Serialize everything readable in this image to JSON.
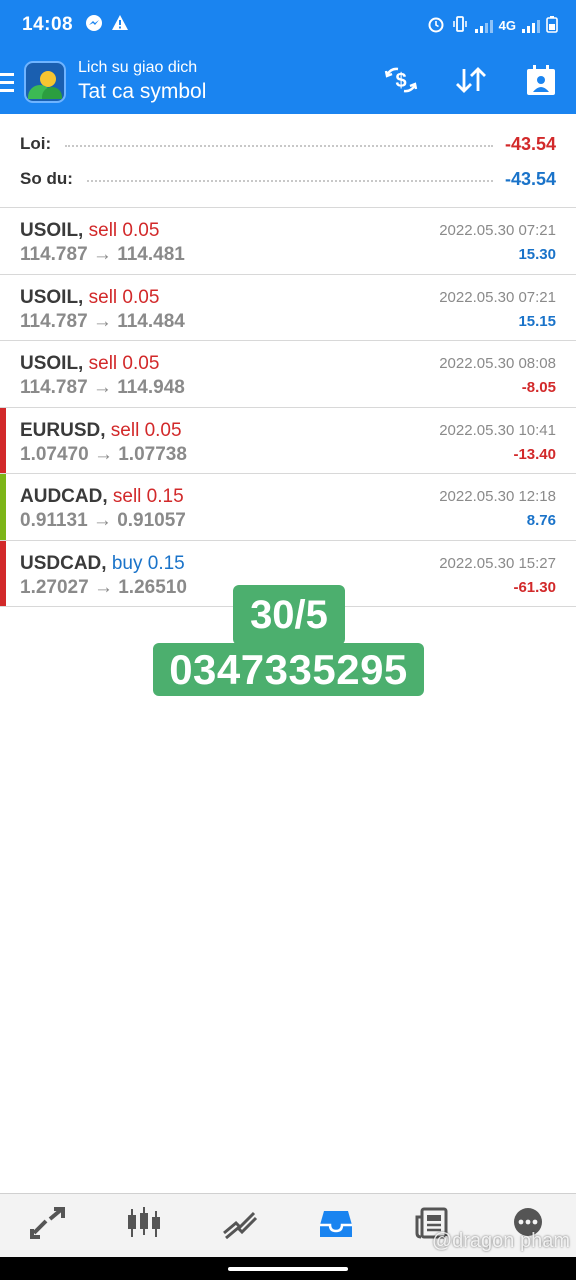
{
  "status_bar": {
    "time": "14:08",
    "network": "4G"
  },
  "app_bar": {
    "subtitle": "Lich su giao dich",
    "title": "Tat ca symbol",
    "icons": [
      "menu-icon",
      "app-logo",
      "currency-exchange-icon",
      "sort-icon",
      "calendar-icon"
    ]
  },
  "summary": {
    "profit_label": "Loi:",
    "profit_value": "-43.54",
    "balance_label": "So du:",
    "balance_value": "-43.54"
  },
  "trades": [
    {
      "symbol": "USOIL,",
      "type": "sell 0.05",
      "side": "sell",
      "prices": "114.787 → 114.481",
      "datetime": "2022.05.30 07:21",
      "profit": "15.30",
      "profit_sign": "pos",
      "marker": ""
    },
    {
      "symbol": "USOIL,",
      "type": "sell 0.05",
      "side": "sell",
      "prices": "114.787 → 114.484",
      "datetime": "2022.05.30 07:21",
      "profit": "15.15",
      "profit_sign": "pos",
      "marker": ""
    },
    {
      "symbol": "USOIL,",
      "type": "sell 0.05",
      "side": "sell",
      "prices": "114.787 → 114.948",
      "datetime": "2022.05.30 08:08",
      "profit": "-8.05",
      "profit_sign": "neg",
      "marker": ""
    },
    {
      "symbol": "EURUSD,",
      "type": "sell 0.05",
      "side": "sell",
      "prices": "1.07470 → 1.07738",
      "datetime": "2022.05.30 10:41",
      "profit": "-13.40",
      "profit_sign": "neg",
      "marker": "#d2292a"
    },
    {
      "symbol": "AUDCAD,",
      "type": "sell 0.15",
      "side": "sell",
      "prices": "0.91131 → 0.91057",
      "datetime": "2022.05.30 12:18",
      "profit": "8.76",
      "profit_sign": "pos",
      "marker": "#7cb518"
    },
    {
      "symbol": "USDCAD,",
      "type": "buy 0.15",
      "side": "buy",
      "prices": "1.27027 → 1.26510",
      "datetime": "2022.05.30 15:27",
      "profit": "-61.30",
      "profit_sign": "neg",
      "marker": "#d2292a"
    }
  ],
  "stamp": {
    "date": "30/5",
    "phone": "0347335295"
  },
  "bottom_nav": {
    "items": [
      "quotes-icon",
      "chart-icon",
      "trade-icon",
      "history-icon",
      "news-icon",
      "chat-icon"
    ],
    "active": "history-icon",
    "active_color": "#1a84f0"
  },
  "watermark": "@dragon pham",
  "colors": {
    "brand": "#1a84f0",
    "loss": "#d2292a",
    "gain": "#1a73c9"
  }
}
